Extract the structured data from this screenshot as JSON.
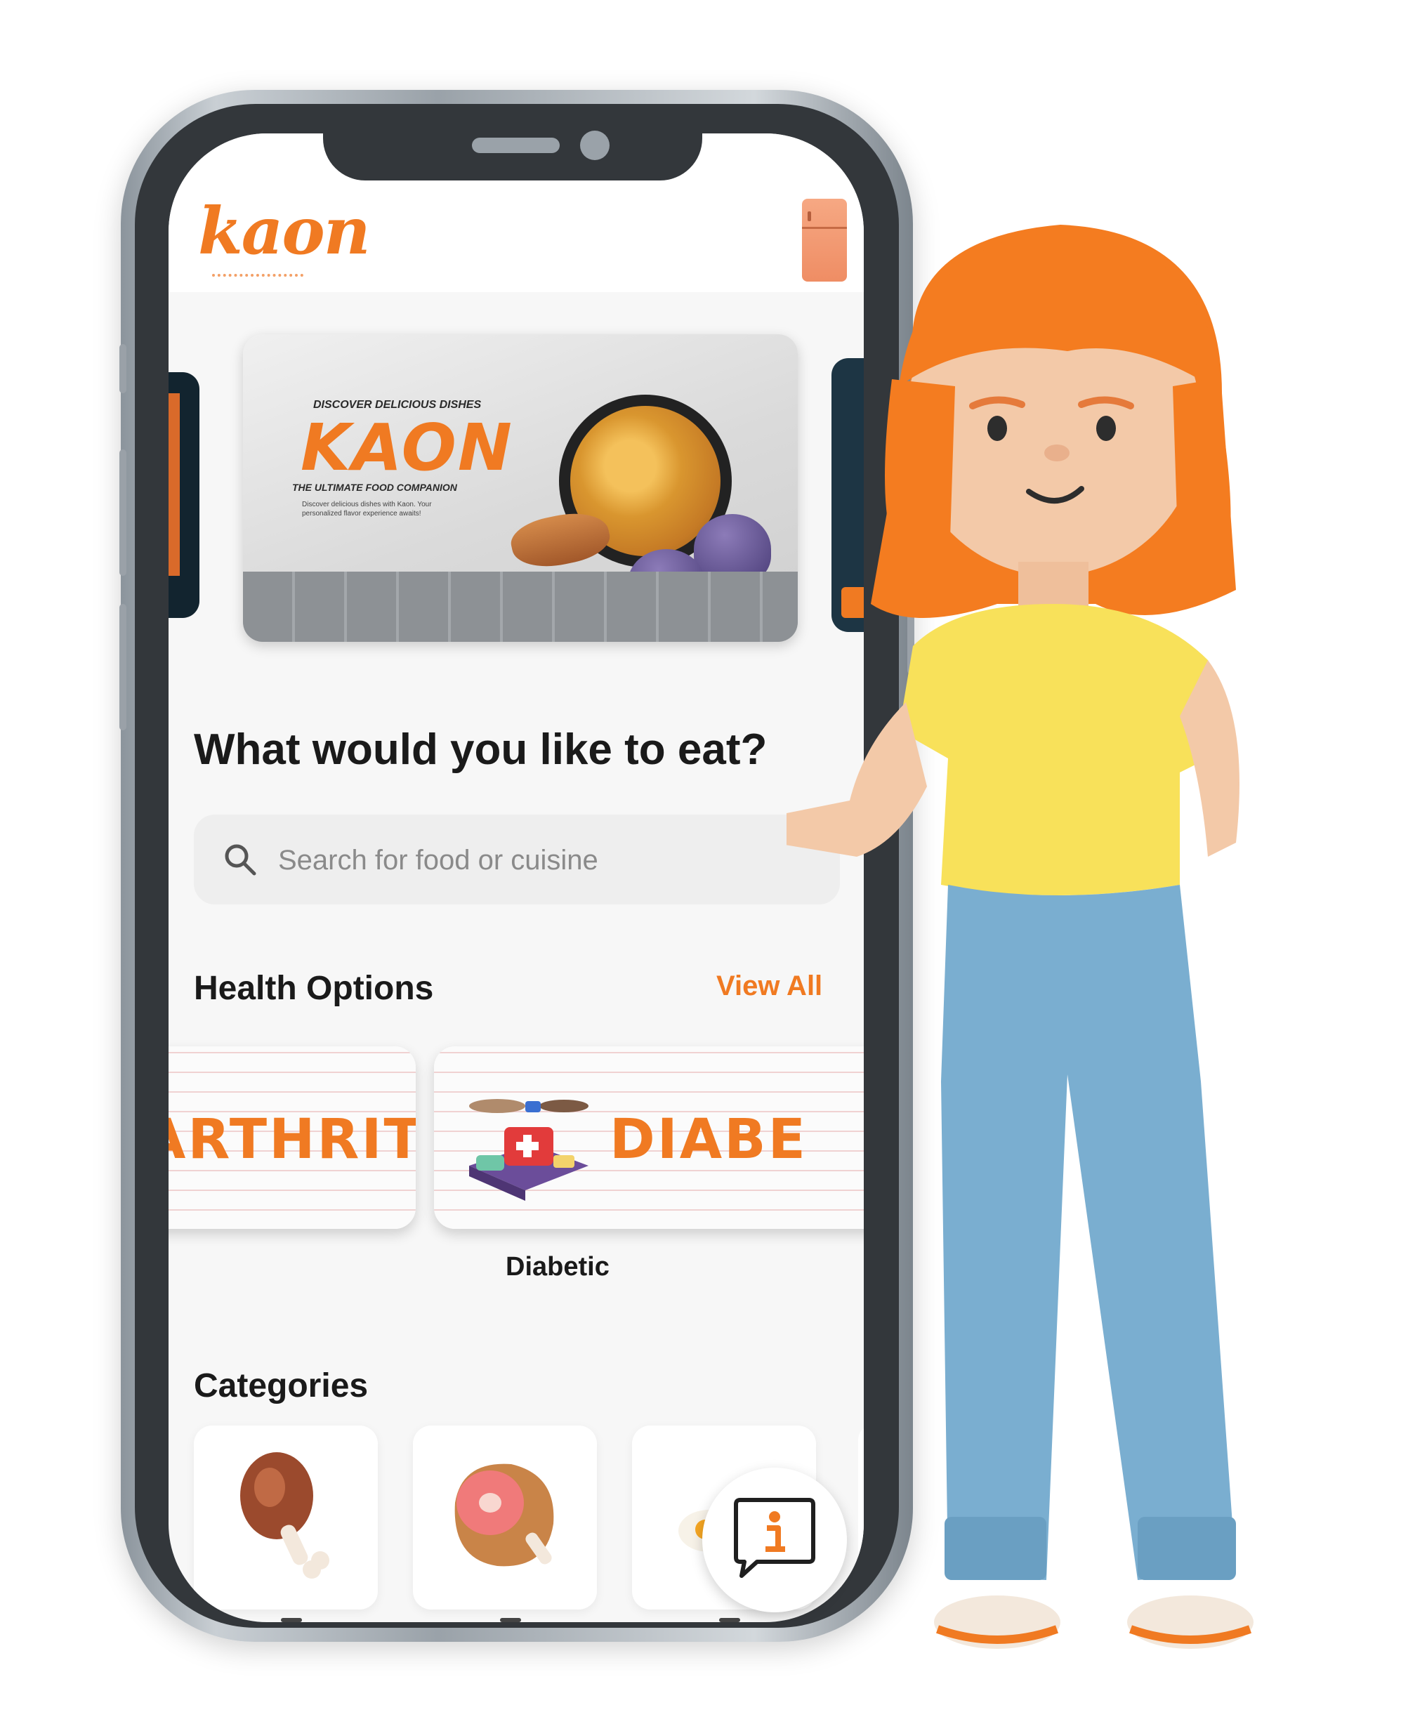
{
  "app": {
    "logo_text": "kaon",
    "colors": {
      "accent": "#f07a22",
      "text": "#1a1a1a",
      "placeholder": "#8a8a8a",
      "background": "#f7f7f7"
    }
  },
  "header": {
    "logo_icon": "kaon-logo",
    "right_icon": "fridge-icon"
  },
  "banner": {
    "tagline": "DISCOVER DELICIOUS DISHES",
    "title": "KAON",
    "subtitle": "THE ULTIMATE FOOD COMPANION",
    "description": "Discover delicious dishes with Kaon. Your personalized flavor experience awaits!"
  },
  "main": {
    "headline": "What would you like to eat?",
    "search": {
      "placeholder": "Search for food or cuisine",
      "value": ""
    }
  },
  "health_options": {
    "title": "Health Options",
    "view_all": "View All",
    "cards": [
      {
        "word": "ARTHRITIS",
        "caption": ""
      },
      {
        "word": "DIABE",
        "caption": "Diabetic"
      }
    ]
  },
  "categories": {
    "title": "Categories",
    "items": [
      {
        "icon": "chicken-leg-icon"
      },
      {
        "icon": "ham-icon"
      },
      {
        "icon": "egg-icon"
      }
    ]
  },
  "help": {
    "icon": "info-chat-icon"
  }
}
